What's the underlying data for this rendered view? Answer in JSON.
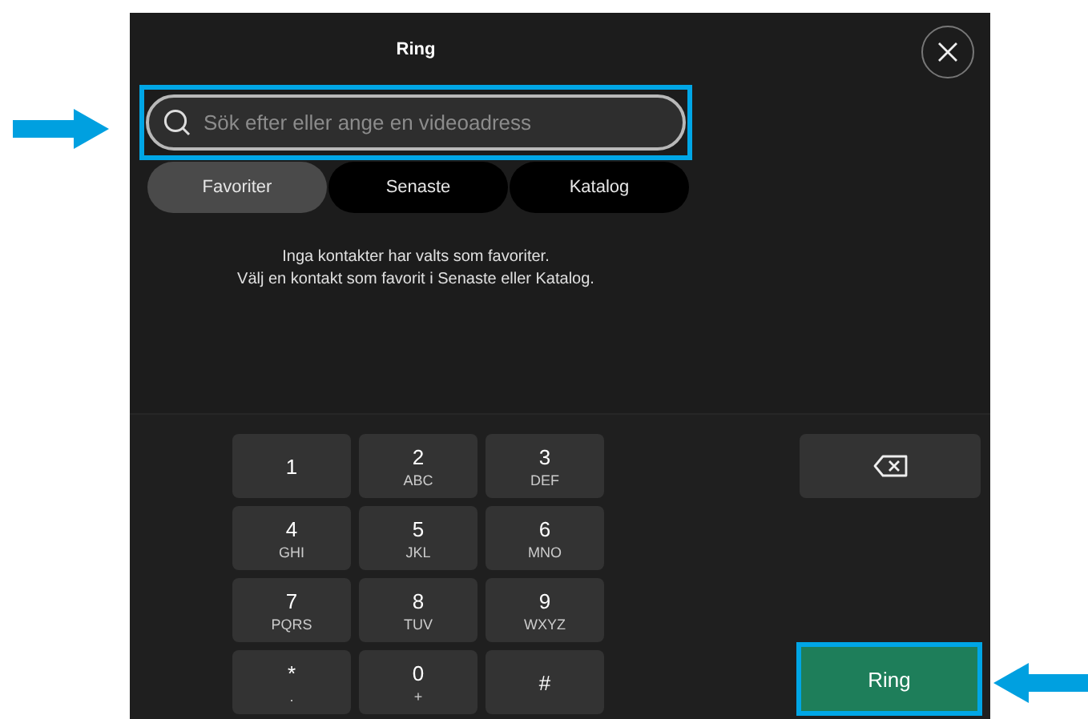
{
  "title": "Ring",
  "search": {
    "placeholder": "Sök efter eller ange en videoadress",
    "highlighted": true
  },
  "tabs": [
    {
      "label": "Favoriter",
      "selected": true
    },
    {
      "label": "Senaste",
      "selected": false
    },
    {
      "label": "Katalog",
      "selected": false
    }
  ],
  "message": [
    "Inga kontakter har valts som favoriter.",
    "Välj en kontakt som favorit i Senaste eller Katalog."
  ],
  "keypad": [
    {
      "digit": "1"
    },
    {
      "digit": "2",
      "letters": "ABC"
    },
    {
      "digit": "3",
      "letters": "DEF"
    },
    {
      "digit": "4",
      "letters": "GHI"
    },
    {
      "digit": "5",
      "letters": "JKL"
    },
    {
      "digit": "6",
      "letters": "MNO"
    },
    {
      "digit": "7",
      "letters": "PQRS"
    },
    {
      "digit": "8",
      "letters": "TUV"
    },
    {
      "digit": "9",
      "letters": "WXYZ"
    },
    {
      "digit": "*",
      "letters": "."
    },
    {
      "digit": "0",
      "letters": "+"
    },
    {
      "digit": "#"
    }
  ],
  "call_button": {
    "label": "Ring",
    "highlighted": true
  }
}
